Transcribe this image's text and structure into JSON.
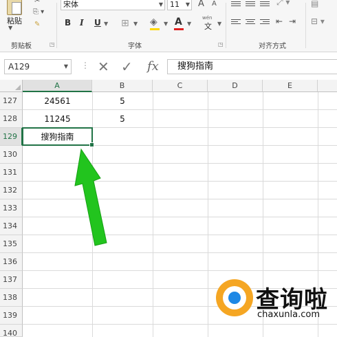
{
  "ribbon": {
    "clipboard": {
      "paste_label": "粘贴",
      "group_label": "剪贴板"
    },
    "font": {
      "font_name": "宋体",
      "font_size": "11",
      "grow": "A",
      "shrink": "A",
      "bold": "B",
      "italic": "I",
      "underline": "U",
      "phonetic_top": "wén",
      "phonetic_char": "文",
      "group_label": "字体"
    },
    "alignment": {
      "group_label": "对齐方式"
    }
  },
  "formula_bar": {
    "name_box": "A129",
    "cancel": "✕",
    "enter": "✓",
    "fx": "fx",
    "content": "搜狗指南"
  },
  "grid": {
    "columns": [
      "A",
      "B",
      "C",
      "D",
      "E"
    ],
    "active_column": "A",
    "rows": [
      {
        "number": "127",
        "a": "24561",
        "b": "5"
      },
      {
        "number": "128",
        "a": "11245",
        "b": "5"
      },
      {
        "number": "129",
        "a": "搜狗指南",
        "b": ""
      },
      {
        "number": "130",
        "a": "",
        "b": ""
      },
      {
        "number": "131",
        "a": "",
        "b": ""
      },
      {
        "number": "132",
        "a": "",
        "b": ""
      },
      {
        "number": "133",
        "a": "",
        "b": ""
      },
      {
        "number": "134",
        "a": "",
        "b": ""
      },
      {
        "number": "135",
        "a": "",
        "b": ""
      },
      {
        "number": "136",
        "a": "",
        "b": ""
      },
      {
        "number": "137",
        "a": "",
        "b": ""
      },
      {
        "number": "138",
        "a": "",
        "b": ""
      },
      {
        "number": "139",
        "a": "",
        "b": ""
      },
      {
        "number": "140",
        "a": "",
        "b": ""
      }
    ],
    "active_row": "129"
  },
  "annotation": {
    "arrow_color": "#22c41e"
  },
  "watermark": {
    "title": "查询啦",
    "url": "chaxunla.com"
  },
  "colors": {
    "accent": "#217346",
    "font_color_bar": "#e02020",
    "fill_color_bar": "#ffd800"
  }
}
